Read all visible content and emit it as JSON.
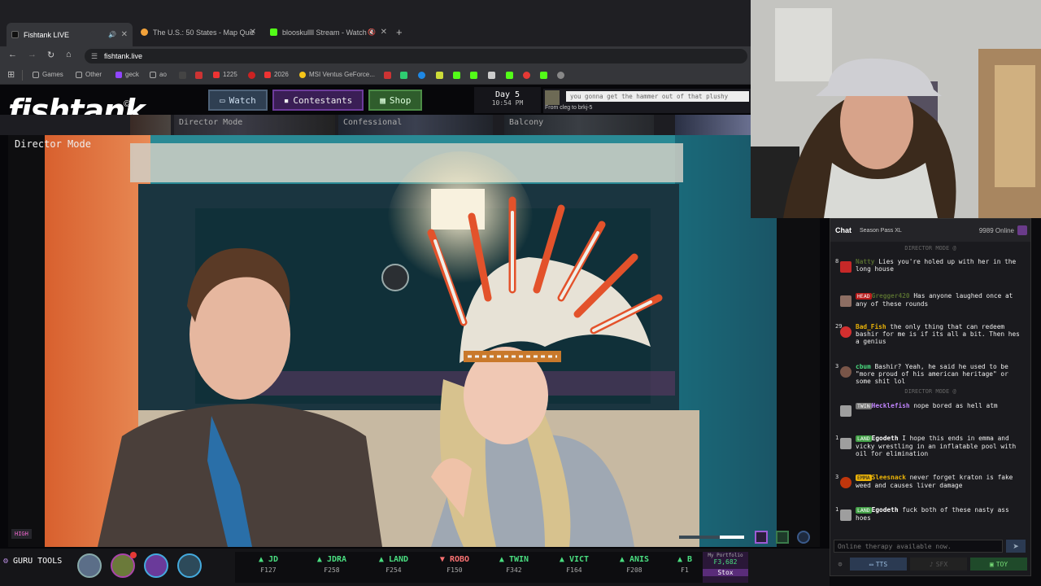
{
  "browser": {
    "tabs": [
      {
        "title": "Fishtank LIVE",
        "active": true
      },
      {
        "title": "The U.S.: 50 States - Map Quiz",
        "active": false
      },
      {
        "title": "blooskullll Stream - Watch",
        "active": false
      }
    ],
    "new_tab": "+",
    "url": "fishtank.live",
    "bookmarks": [
      "Games",
      "Other",
      "geck",
      "ao",
      "1225",
      "2026",
      "MSI Ventus GeForce..."
    ]
  },
  "site": {
    "logo": "fishtank",
    "nav": {
      "watch": "Watch",
      "contestants": "Contestants",
      "shop": "Shop"
    },
    "day": "Day 5",
    "time": "10:54 PM",
    "tts": {
      "message": "you gonna get the hammer out of that plushy",
      "from": "From cleg to brkj-5"
    },
    "cams": [
      "Director Mode",
      "Confessional",
      "Balcony"
    ],
    "main_cam_label": "Director Mode",
    "quality": "HIGH",
    "guru_tools": "GURU TOOLS",
    "ticker": [
      {
        "name": "JD",
        "price": "₣127",
        "dir": "up"
      },
      {
        "name": "JDRA",
        "price": "₣258",
        "dir": "up"
      },
      {
        "name": "LAND",
        "price": "₣254",
        "dir": "up"
      },
      {
        "name": "ROBO",
        "price": "₣150",
        "dir": "dn"
      },
      {
        "name": "TWIN",
        "price": "₣342",
        "dir": "up"
      },
      {
        "name": "VICT",
        "price": "₣164",
        "dir": "up"
      },
      {
        "name": "ANIS",
        "price": "₣208",
        "dir": "up"
      },
      {
        "name": "B",
        "price": "₣1",
        "dir": "up"
      }
    ],
    "portfolio": {
      "label": "My Portfolio",
      "value": "₣3,682",
      "button": "Stox"
    }
  },
  "chat": {
    "title": "Chat",
    "season_pass": "Season Pass XL",
    "online": "9989 Online",
    "messages": [
      {
        "num": "8",
        "user": "Natty",
        "badge": "",
        "text": "Lies you're holed up with her in the long house",
        "color": "#8bc34a"
      },
      {
        "num": "",
        "user": "Gregger420",
        "badge": "HEAD",
        "text": "Has anyone laughed once at any of these rounds",
        "color": "#8bc34a"
      },
      {
        "num": "29",
        "user": "Bad_Fish",
        "badge": "",
        "text": "the only thing that can redeem bashir for me is if its all a bit. Then hes a genius",
        "color": "#eab308"
      },
      {
        "num": "3",
        "user": "cbum",
        "badge": "",
        "text": "Bashir? Yeah, he said he used to be \"more proud of his american heritage\" or some shit lol",
        "color": "#4ade80"
      },
      {
        "num": "",
        "user": "Hecklefish",
        "badge": "TWIN",
        "text": "nope bored as hell atm",
        "color": "#c084fc"
      },
      {
        "num": "1",
        "user": "Egodeth",
        "badge": "LAND",
        "text": "I hope this ends in emma and vicky wrestling in an inflatable pool with oil for elimination",
        "color": "#fff"
      },
      {
        "num": "3",
        "user": "Sleesnack",
        "badge": "EMMA",
        "text": "never forget kraton is fake weed and causes liver damage",
        "color": "#eab308"
      },
      {
        "num": "1",
        "user": "Egodeth",
        "badge": "LAND",
        "text": "fuck both of these nasty ass hoes",
        "color": "#fff"
      }
    ],
    "system": "DIRECTOR MODE @",
    "input_placeholder": "Online therapy available now.",
    "footer": {
      "tts": "TTS",
      "sfx": "SFX",
      "toy": "TOY"
    }
  }
}
